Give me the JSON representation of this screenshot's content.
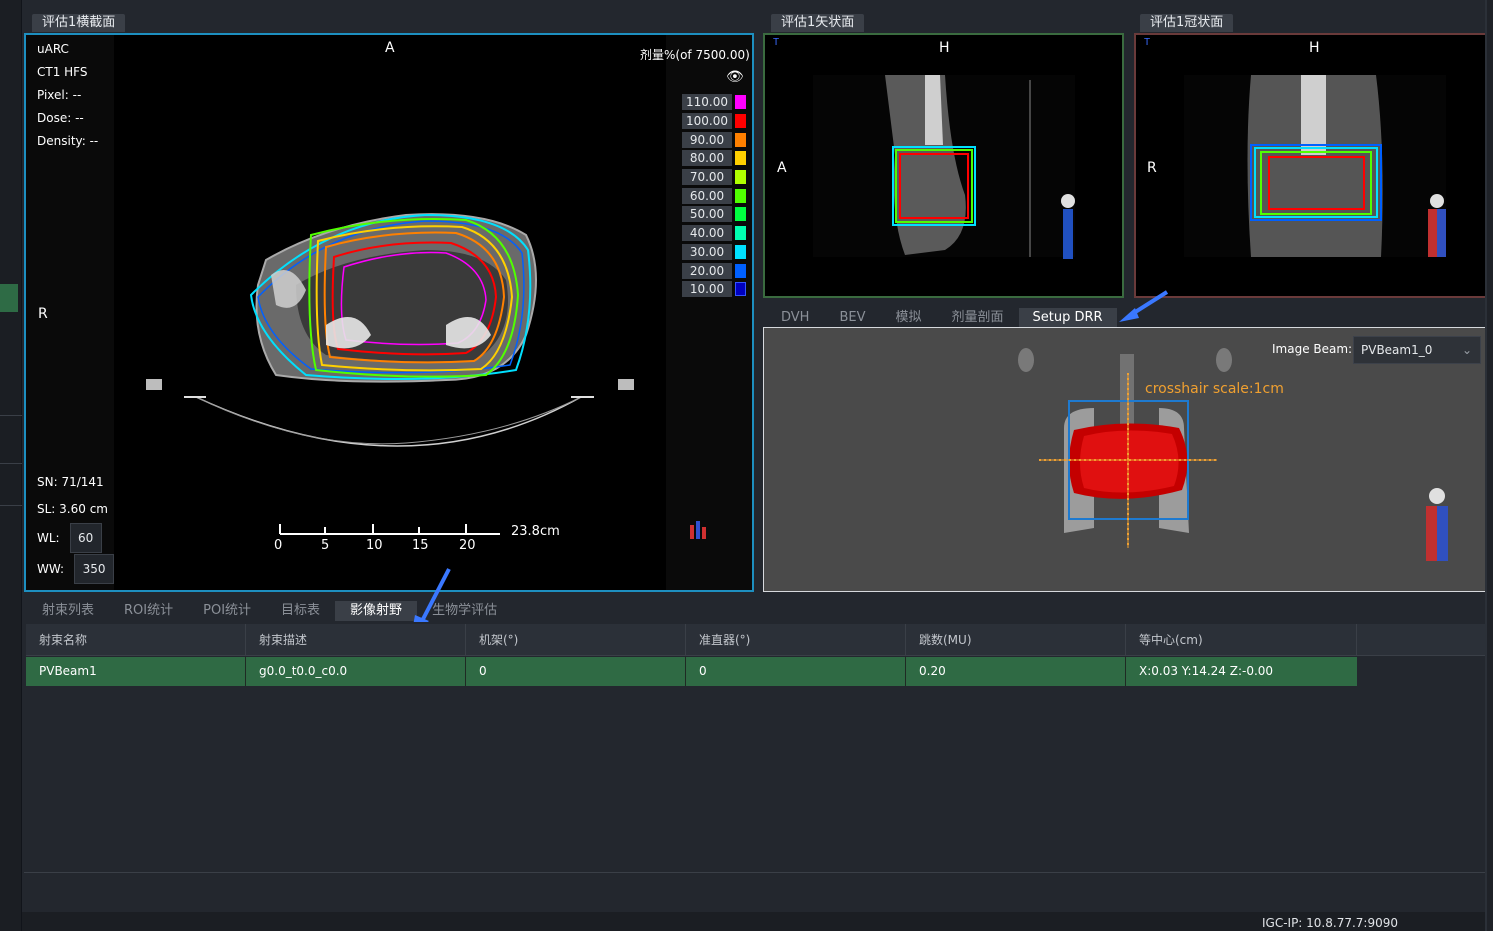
{
  "transverse": {
    "title": "评估1横截面",
    "info": [
      "uARC",
      "CT1 HFS",
      "Pixel: --",
      "Dose: --",
      "Density: --"
    ],
    "orient_top": "A",
    "orient_left": "R",
    "dose_header": "剂量%(of 7500.00)",
    "dose_levels": [
      {
        "value": "110.00",
        "color": "#ff00ff"
      },
      {
        "value": "100.00",
        "color": "#ff0000"
      },
      {
        "value": "90.00",
        "color": "#ff8000"
      },
      {
        "value": "80.00",
        "color": "#ffd000"
      },
      {
        "value": "70.00",
        "color": "#b0ff00"
      },
      {
        "value": "60.00",
        "color": "#50ff00"
      },
      {
        "value": "50.00",
        "color": "#00ff40"
      },
      {
        "value": "40.00",
        "color": "#00ffb0"
      },
      {
        "value": "30.00",
        "color": "#00e0ff"
      },
      {
        "value": "20.00",
        "color": "#0060ff"
      },
      {
        "value": "10.00",
        "color": "#0000c0"
      }
    ],
    "sn": "SN: 71/141",
    "sl": "SL: 3.60 cm",
    "wl_label": "WL:",
    "wl_value": "60",
    "ww_label": "WW:",
    "ww_value": "350",
    "scale_ticks": [
      "0",
      "5",
      "10",
      "15",
      "20"
    ],
    "scale_length": "23.8cm"
  },
  "sagittal": {
    "title": "评估1矢状面",
    "orient_top": "H",
    "orient_left": "A"
  },
  "coronal": {
    "title": "评估1冠状面",
    "orient_top": "H",
    "orient_left": "R"
  },
  "right_tabs": [
    "DVH",
    "BEV",
    "模拟",
    "剂量剖面",
    "Setup DRR"
  ],
  "right_tabs_active": "Setup DRR",
  "drr": {
    "image_beam_label": "Image Beam:",
    "image_beam_value": "PVBeam1_0",
    "crosshair": "crosshair scale:1cm"
  },
  "bottom_tabs": [
    "射束列表",
    "ROI统计",
    "POI统计",
    "目标表",
    "影像射野",
    "生物学评估"
  ],
  "bottom_tabs_active": "影像射野",
  "table": {
    "headers": [
      "射束名称",
      "射束描述",
      "机架(°)",
      "准直器(°)",
      "跳数(MU)",
      "等中心(cm)"
    ],
    "rows": [
      [
        "PVBeam1",
        "g0.0_t0.0_c0.0",
        "0",
        "0",
        "0.20",
        "X:0.03 Y:14.24 Z:-0.00"
      ]
    ]
  },
  "status": {
    "ip": "IGC-IP: 10.8.77.7:9090"
  }
}
